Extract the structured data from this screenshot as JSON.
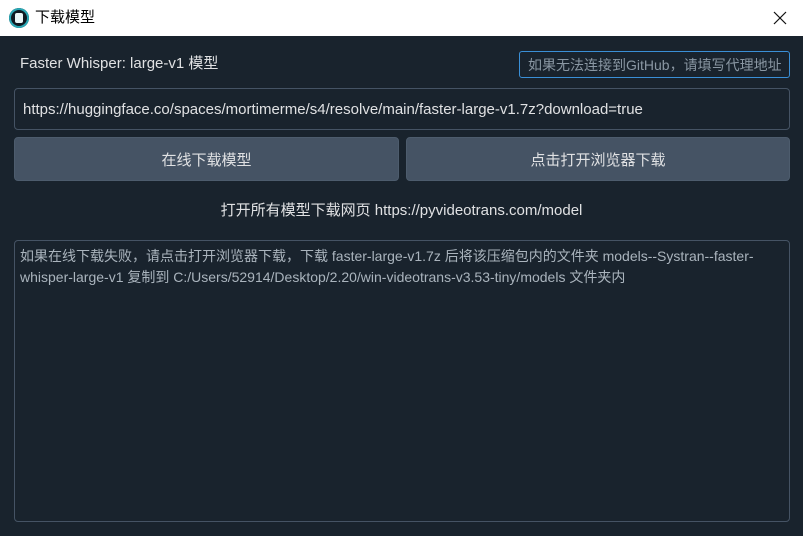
{
  "window": {
    "title": "下载模型",
    "app_icon": "app-logo-icon",
    "close_icon": "close-icon"
  },
  "model": {
    "label": "Faster Whisper:  large-v1 模型"
  },
  "proxy": {
    "value": "",
    "placeholder": "如果无法连接到GitHub，请填写代理地址"
  },
  "download_url": {
    "value": "https://huggingface.co/spaces/mortimerme/s4/resolve/main/faster-large-v1.7z?download=true"
  },
  "buttons": {
    "online_download": "在线下载模型",
    "browser_download": "点击打开浏览器下载"
  },
  "all_models_link": "打开所有模型下载网页 https://pyvideotrans.com/model",
  "info_text": "如果在线下载失败，请点击打开浏览器下载，下载 faster-large-v1.7z 后将该压缩包内的文件夹 models--Systran--faster-whisper-large-v1 复制到 C:/Users/52914/Desktop/2.20/win-videotrans-v3.53-tiny/models 文件夹内",
  "colors": {
    "background": "#19232d",
    "button": "#455364",
    "focus_border": "#3a8fd6",
    "text": "#e0e1e3"
  }
}
